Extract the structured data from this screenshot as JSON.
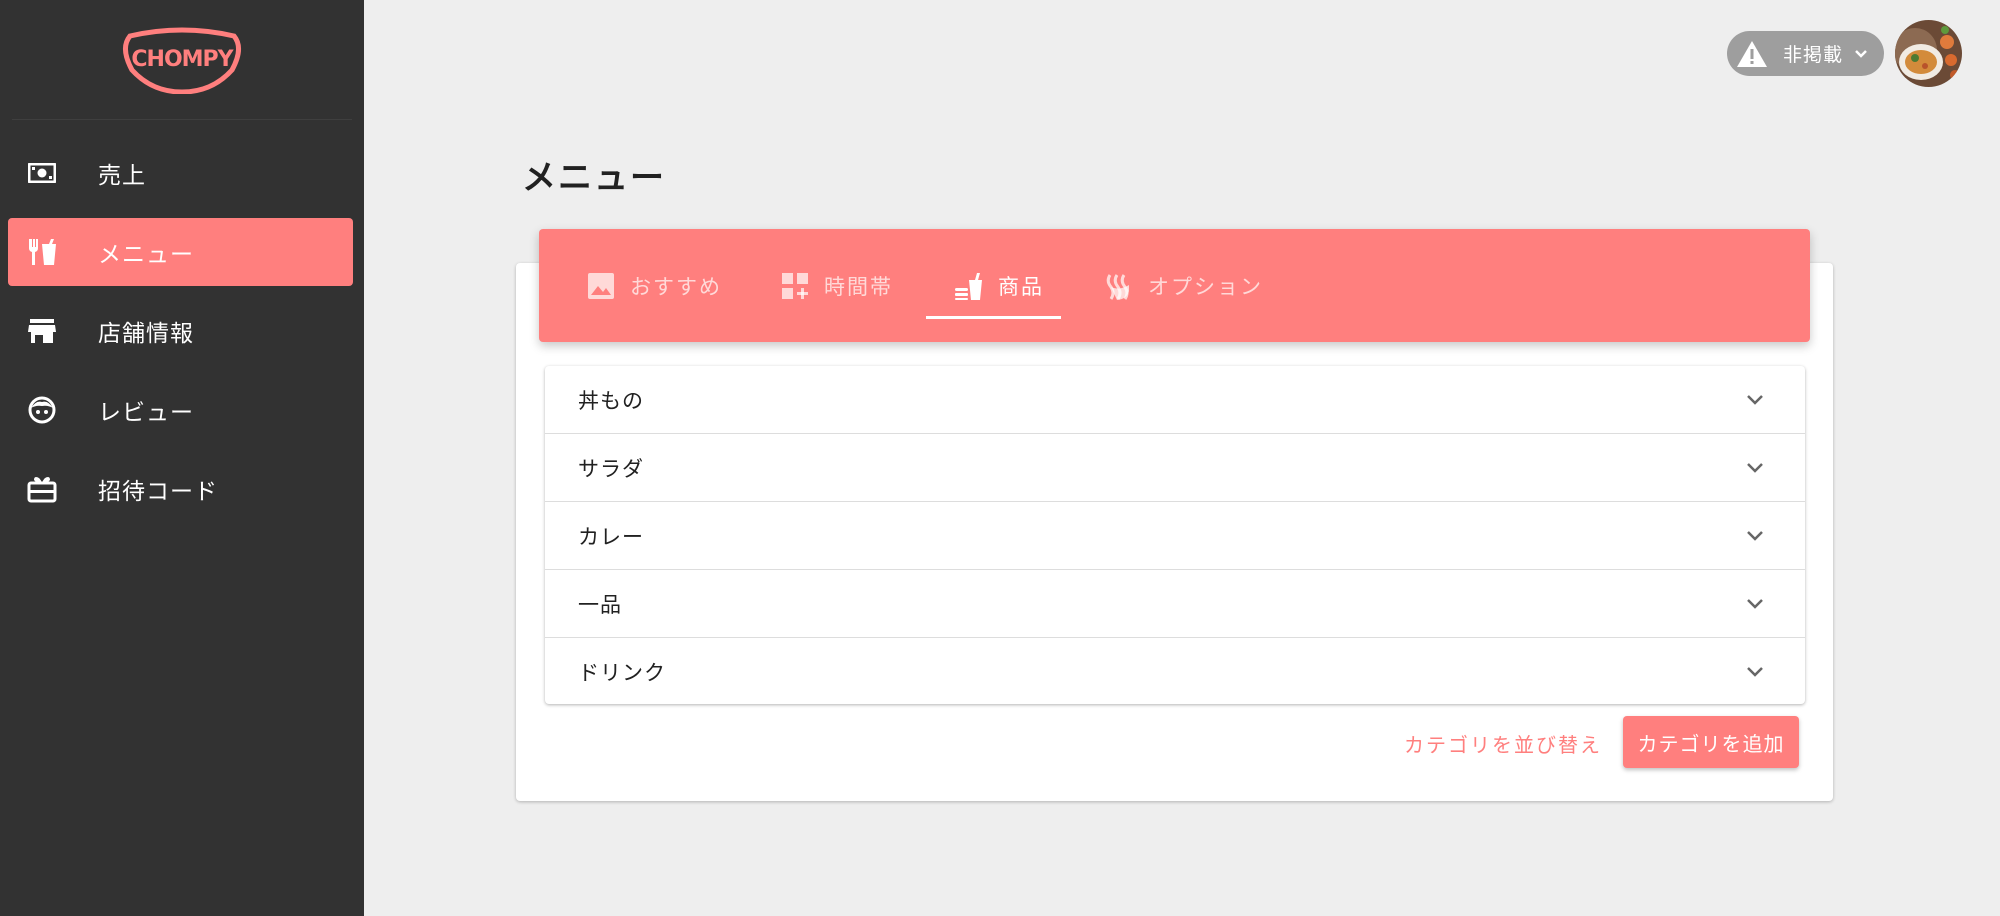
{
  "brand": {
    "logo_text": "CHOMPY",
    "accent": "#ff7f7e",
    "sidebar_bg": "#323232"
  },
  "sidebar": {
    "items": [
      {
        "label": "売上",
        "icon": "money-icon",
        "active": false
      },
      {
        "label": "メニュー",
        "icon": "restaurant-icon",
        "active": true
      },
      {
        "label": "店舗情報",
        "icon": "store-icon",
        "active": false
      },
      {
        "label": "レビュー",
        "icon": "face-icon",
        "active": false
      },
      {
        "label": "招待コード",
        "icon": "gift-card-icon",
        "active": false
      }
    ]
  },
  "header": {
    "status_label": "非掲載",
    "status_icon": "warning-icon",
    "avatar": "user-avatar"
  },
  "main": {
    "title": "メニュー",
    "tabs": [
      {
        "label": "おすすめ",
        "icon": "image-icon",
        "active": false
      },
      {
        "label": "時間帯",
        "icon": "dashboard-add-icon",
        "active": false
      },
      {
        "label": "商品",
        "icon": "fastfood-icon",
        "active": true
      },
      {
        "label": "オプション",
        "icon": "hot-icon",
        "active": false
      }
    ],
    "categories": [
      "丼もの",
      "サラダ",
      "カレー",
      "一品",
      "ドリンク"
    ],
    "reorder_label": "カテゴリを並び替え",
    "add_label": "カテゴリを追加"
  }
}
